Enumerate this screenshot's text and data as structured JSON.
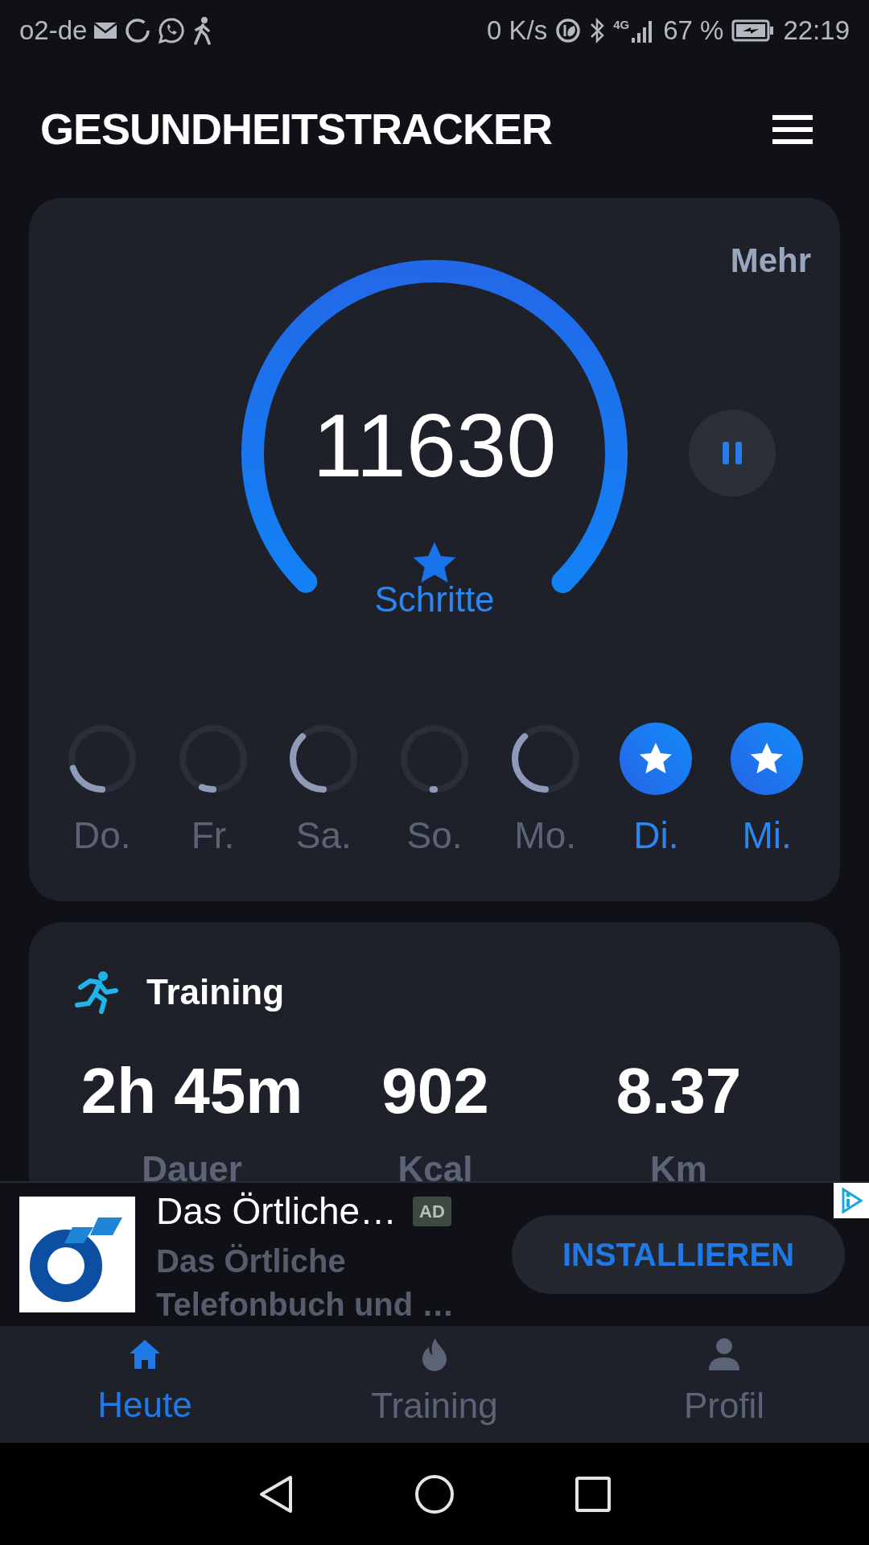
{
  "status_bar": {
    "carrier": "o2-de",
    "speed": "0 K/s",
    "network": "4G",
    "battery": "67 %",
    "time": "22:19"
  },
  "header": {
    "title": "GESUNDHEITSTRACKER"
  },
  "steps_card": {
    "more": "Mehr",
    "steps": "11630",
    "label": "Schritte",
    "days": [
      {
        "label": "Do.",
        "goal_reached": false
      },
      {
        "label": "Fr.",
        "goal_reached": false
      },
      {
        "label": "Sa.",
        "goal_reached": false
      },
      {
        "label": "So.",
        "goal_reached": false
      },
      {
        "label": "Mo.",
        "goal_reached": false
      },
      {
        "label": "Di.",
        "goal_reached": true
      },
      {
        "label": "Mi.",
        "goal_reached": true
      }
    ]
  },
  "training_card": {
    "title": "Training",
    "stats": [
      {
        "value": "2h 45m",
        "label": "Dauer"
      },
      {
        "value": "902",
        "label": "Kcal"
      },
      {
        "value": "8.37",
        "label": "Km"
      }
    ]
  },
  "ad": {
    "title": "Das Örtliche…",
    "badge": "AD",
    "description": "Das Örtliche Telefonbuch und …",
    "button": "INSTALLIEREN"
  },
  "bottom_nav": [
    {
      "label": "Heute",
      "selected": true
    },
    {
      "label": "Training",
      "selected": false
    },
    {
      "label": "Profil",
      "selected": false
    }
  ]
}
